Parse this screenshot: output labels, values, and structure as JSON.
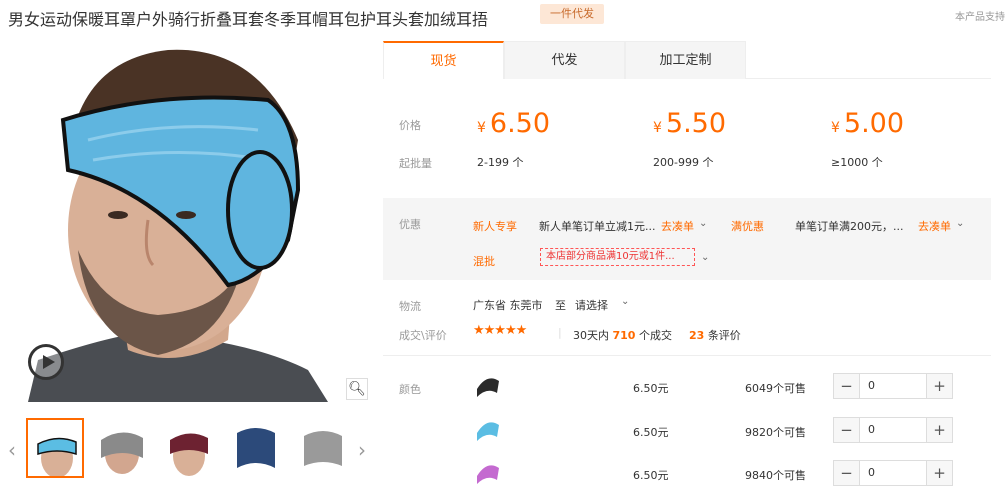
{
  "product": {
    "title": "男女运动保暖耳罩户外骑行折叠耳套冬季耳帽耳包护耳头套加绒耳捂",
    "badge": "一件代发",
    "support_note": "本产品支持"
  },
  "tabs": [
    {
      "label": "现货",
      "active": true
    },
    {
      "label": "代发",
      "active": false
    },
    {
      "label": "加工定制",
      "active": false
    }
  ],
  "price": {
    "label": "价格",
    "moq_label": "起批量",
    "currency": "¥",
    "tiers": [
      {
        "price": "6.50",
        "range": "2-199 个"
      },
      {
        "price": "5.50",
        "range": "200-999 个"
      },
      {
        "price": "5.00",
        "range": "≥1000 个"
      }
    ]
  },
  "promo": {
    "label": "优惠",
    "new_user_tag": "新人专享",
    "new_user_text": "新人单笔订单立减1元...",
    "collect_label": "去凑单",
    "full_discount_tag": "满优惠",
    "full_discount_text": "单笔订单满200元，...",
    "collect_label_2": "去凑单",
    "mix_label": "混批",
    "mix_text": "本店部分商品满10元或1件..."
  },
  "shipping": {
    "label": "物流",
    "origin": "广东省 东莞市",
    "to": "至",
    "dest": "请选择"
  },
  "deals": {
    "label": "成交\\评价",
    "stars": "★★★★★",
    "period": "30天内",
    "count": "710",
    "count_suffix": "个成交",
    "reviews": "23",
    "reviews_suffix": "条评价"
  },
  "sku": {
    "label": "颜色",
    "rows": [
      {
        "color": "#2b2b2b",
        "price": "6.50元",
        "stock": "6049个可售",
        "qty": "0"
      },
      {
        "color": "#5bbde3",
        "price": "6.50元",
        "stock": "9820个可售",
        "qty": "0"
      },
      {
        "color": "#c46ad0",
        "price": "6.50元",
        "stock": "9840个可售",
        "qty": "0"
      }
    ],
    "minus": "−",
    "plus": "+"
  },
  "gallery": {
    "thumbnail_colors": [
      "#5bbde3",
      "#8a8a8a",
      "#6d2231",
      "#2c4a7a",
      "#9a9a9a"
    ]
  }
}
